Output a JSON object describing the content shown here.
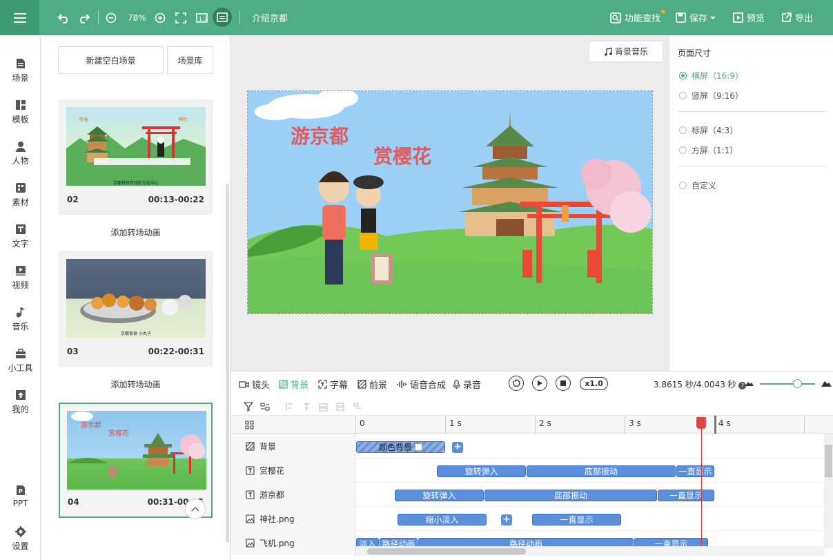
{
  "topbar": {
    "zoom": "78%",
    "project_title": "介绍京都",
    "feature_search": "功能查找",
    "save": "保存",
    "preview": "预览",
    "export": "导出",
    "colors": {
      "bar": "#4fac84",
      "accent": "#4fac84"
    }
  },
  "nav": [
    {
      "label": "场景",
      "icon": "scene-icon"
    },
    {
      "label": "模板",
      "icon": "template-icon"
    },
    {
      "label": "人物",
      "icon": "person-icon"
    },
    {
      "label": "素材",
      "icon": "material-icon"
    },
    {
      "label": "文字",
      "icon": "text-icon"
    },
    {
      "label": "视频",
      "icon": "video-icon"
    },
    {
      "label": "音乐",
      "icon": "music-icon"
    },
    {
      "label": "小工具",
      "icon": "toolbox-icon"
    },
    {
      "label": "我的",
      "icon": "mine-icon"
    },
    {
      "label": "PPT",
      "icon": "ppt-icon"
    },
    {
      "label": "设置",
      "icon": "settings-icon"
    }
  ],
  "scenes": {
    "new_blank": "新建空白场景",
    "library": "场景库",
    "add_transition": "添加转场动画",
    "cards": [
      {
        "num": "02",
        "time": "00:13-00:22",
        "thumb_title_a": "寺庙",
        "thumb_title_b": "神社",
        "thumb_caption": "京都每日参拜的文化中心"
      },
      {
        "num": "03",
        "time": "00:22-00:31",
        "thumb_caption": "京都美食 小丸子"
      },
      {
        "num": "04",
        "time": "00:31-00:35",
        "thumb_title_a": "游京都",
        "thumb_title_b": "赏樱花"
      }
    ]
  },
  "canvas": {
    "bg_music": "背景音乐",
    "title1": "游京都",
    "title2": "赏樱花"
  },
  "page_size": {
    "title": "页面尺寸",
    "options": [
      "横屏（16:9）",
      "竖屏（9:16）",
      "标屏（4:3）",
      "方屏（1:1）",
      "自定义"
    ],
    "selected": "横屏（16:9）"
  },
  "timeline": {
    "tabs": [
      "镜头",
      "背景",
      "字幕",
      "前景",
      "语音合成",
      "录音"
    ],
    "active_tab": "背景",
    "speed": "x1.0",
    "time_readout": "3.8615 秒/4.0043 秒",
    "ruler": [
      "0",
      "1 s",
      "2 s",
      "3 s",
      "4 s"
    ],
    "tracks": [
      {
        "name": "背景",
        "clips": [
          "颜色背景"
        ]
      },
      {
        "name": "赏樱花",
        "clips": [
          "旋转弹入",
          "底部振动",
          "一直显示"
        ]
      },
      {
        "name": "游京都",
        "clips": [
          "旋转弹入",
          "底部振动",
          "一直显示"
        ]
      },
      {
        "name": "神社.png",
        "clips": [
          "缩小淡入",
          "一直显示"
        ]
      },
      {
        "name": "飞机.png",
        "clips": [
          "淡入",
          "路径动画",
          "路径动画",
          "一直显示"
        ]
      }
    ]
  }
}
